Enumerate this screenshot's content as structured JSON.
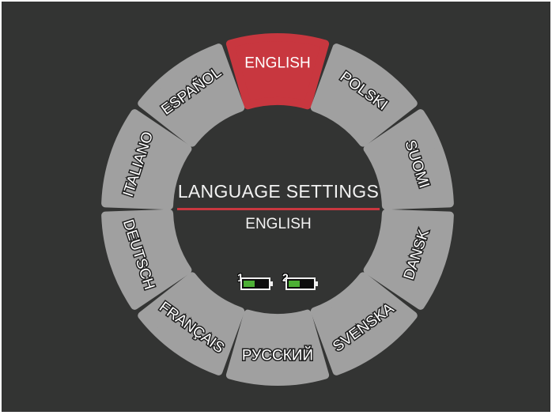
{
  "header": {
    "title": "LANGUAGE SETTINGS",
    "current_value": "ENGLISH"
  },
  "selected": "ENGLISH",
  "languages": [
    "ENGLISH",
    "POLSKI",
    "SUOMI",
    "DANSK",
    "SVENSKA",
    "РУССКИЙ",
    "FRANÇAIS",
    "DEUTSCH",
    "ITALIANO",
    "ESPAÑOL"
  ],
  "batteries": [
    {
      "label": "1",
      "level": 0.45
    },
    {
      "label": "2",
      "level": 0.45
    }
  ],
  "colors": {
    "background": "#333433",
    "segment": "#a0a0a0",
    "selected_segment": "#c8373f",
    "divider": "#c8373f",
    "battery_fill": "#4caf35"
  }
}
